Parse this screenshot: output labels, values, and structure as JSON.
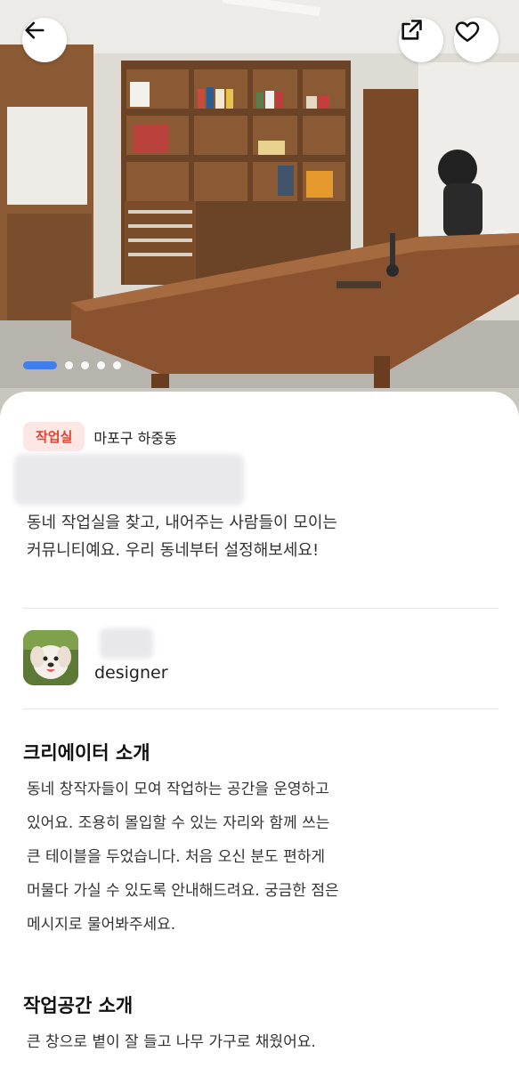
{
  "category_chip": "작업실",
  "location": "마포구 하중동",
  "intro_lines": [
    "동네 작업실을 찾고, 내어주는 사람들이 모이는",
    "커뮤니티예요. 우리 동네부터 설정해보세요!"
  ],
  "host": {
    "role": "designer"
  },
  "creator_section": {
    "title": "크리에이터 소개",
    "lines": [
      "동네 창작자들이 모여 작업하는 공간을 운영하고",
      "있어요. 조용히 몰입할 수 있는 자리와 함께 쓰는",
      "큰 테이블을 두었습니다. 처음 오신 분도 편하게",
      "머물다 가실 수 있도록 안내해드려요. 궁금한 점은",
      "메시지로 물어봐주세요."
    ]
  },
  "space_section": {
    "title": "작업공간 소개",
    "lines": [
      "큰 창으로 볕이 잘 들고 나무 가구로 채웠어요."
    ]
  },
  "carousel": {
    "count": 5,
    "active_index": 0
  },
  "colors": {
    "accent_red": "#e8412d",
    "chip_bg": "#fde7e4",
    "carousel_active": "#3b7bf0"
  },
  "icons": {
    "back": "arrow-left-icon",
    "share": "share-external-icon",
    "like": "heart-outline-icon"
  }
}
